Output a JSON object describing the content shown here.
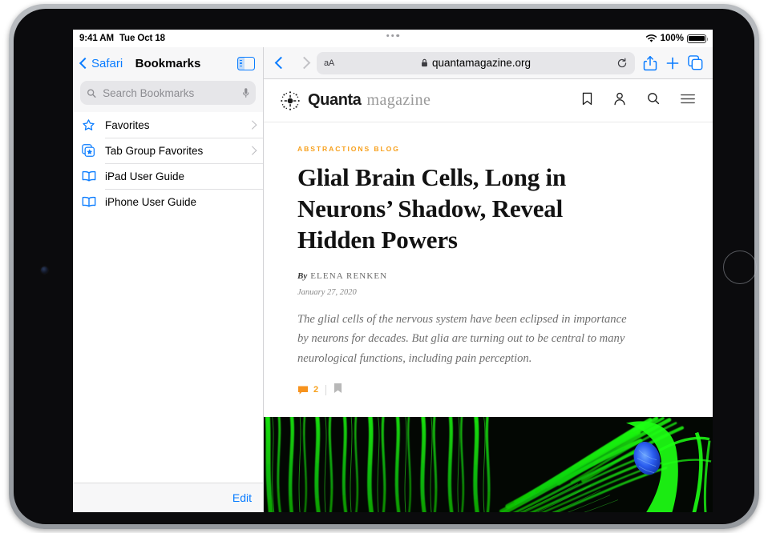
{
  "status_bar": {
    "time": "9:41 AM",
    "date": "Tue Oct 18",
    "battery_percent": "100%",
    "wifi_icon": "wifi-icon",
    "battery_icon": "battery-icon"
  },
  "sidebar": {
    "back_label": "Safari",
    "title": "Bookmarks",
    "toggle_icon": "sidebar-toggle-icon",
    "search": {
      "placeholder": "Search Bookmarks",
      "value": "",
      "search_icon": "search-icon",
      "mic_icon": "microphone-icon"
    },
    "items": [
      {
        "label": "Favorites",
        "icon": "star-icon",
        "has_chevron": true
      },
      {
        "label": "Tab Group Favorites",
        "icon": "tab-group-star-icon",
        "has_chevron": true
      },
      {
        "label": "iPad User Guide",
        "icon": "book-icon",
        "has_chevron": false
      },
      {
        "label": "iPhone User Guide",
        "icon": "book-icon",
        "has_chevron": false
      }
    ],
    "footer": {
      "edit_label": "Edit"
    }
  },
  "toolbar": {
    "back_icon": "chevron-left-icon",
    "forward_icon": "chevron-right-icon",
    "text_size_label": "aA",
    "lock_icon": "lock-icon",
    "url": "quantamagazine.org",
    "reload_icon": "reload-icon",
    "share_icon": "share-icon",
    "new_tab_icon": "plus-icon",
    "tabs_icon": "tabs-icon"
  },
  "site": {
    "logo_mark": "quanta-sunburst-icon",
    "logo_bold": "Quanta",
    "logo_light": "magazine",
    "nav_icons": [
      {
        "name": "bookmark-icon"
      },
      {
        "name": "account-icon"
      },
      {
        "name": "search-icon"
      },
      {
        "name": "hamburger-menu-icon"
      }
    ]
  },
  "article": {
    "kicker": "ABSTRACTIONS BLOG",
    "headline": "Glial Brain Cells, Long in Neurons’ Shadow, Reveal Hidden Powers",
    "by_label": "By",
    "author": "ELENA RENKEN",
    "date": "January 27, 2020",
    "deck": "The glial cells of the nervous system have been eclipsed in importance by neurons for decades. But glia are turning out to be central to many neurological functions, including pain perception.",
    "comment_count": "2",
    "comment_icon": "comment-bubble-icon",
    "save_icon": "bookmark-icon",
    "hero_alt": "Fluorescence micrograph of green glial cell filaments with a blue cell nucleus"
  },
  "colors": {
    "accent_blue": "#0a7cff",
    "quanta_orange": "#f7a01c",
    "hero_green": "#22e818",
    "hero_nucleus_blue": "#2a5cf0"
  }
}
